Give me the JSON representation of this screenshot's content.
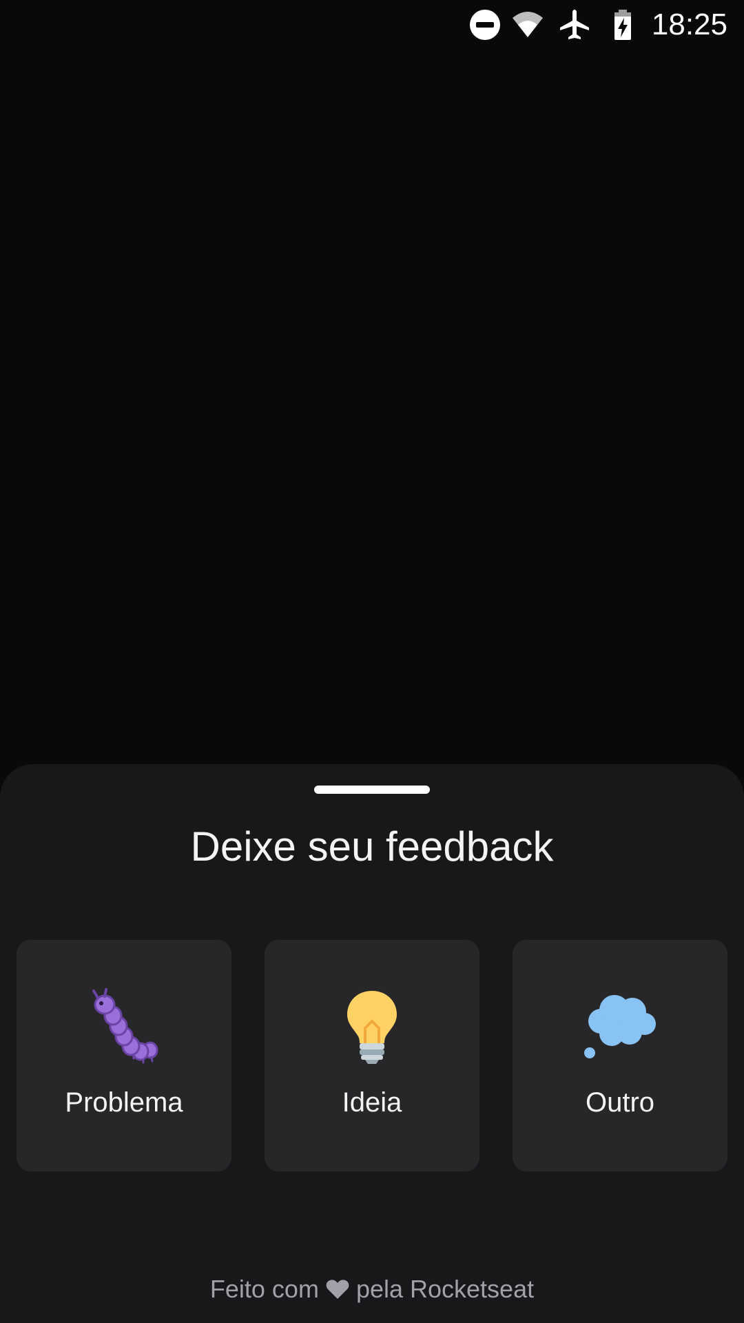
{
  "status_bar": {
    "time": "18:25",
    "icons": [
      "do-not-disturb-icon",
      "wifi-icon",
      "airplane-mode-icon",
      "battery-charging-icon"
    ]
  },
  "sheet": {
    "title": "Deixe seu feedback",
    "options": [
      {
        "label": "Problema",
        "icon": "bug-icon",
        "color": "#9b6fd9"
      },
      {
        "label": "Ideia",
        "icon": "lightbulb-icon",
        "color": "#ffd266"
      },
      {
        "label": "Outro",
        "icon": "thought-bubble-icon",
        "color": "#89c3f3"
      }
    ],
    "footer": {
      "prefix": "Feito com",
      "icon": "heart-icon",
      "middle": "pela",
      "link": "Rocketseat"
    }
  },
  "colors": {
    "background": "#09090a",
    "sheet": "#18181b",
    "card": "#27272a",
    "text": "#f4f4f5",
    "muted": "#a1a1aa"
  }
}
